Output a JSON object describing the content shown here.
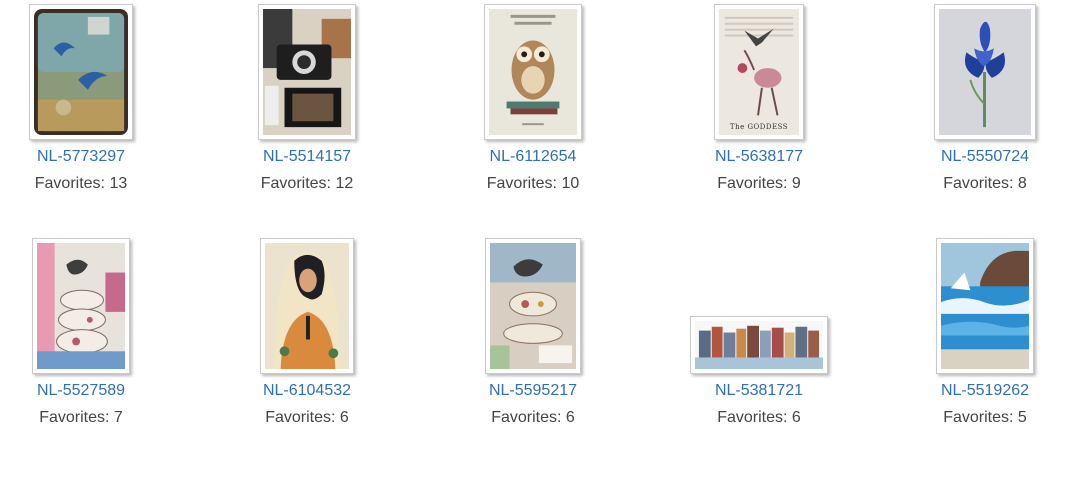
{
  "cards": [
    {
      "id": "NL-5773297",
      "favorites_label": "Favorites: 13",
      "thumbnail": "blue-birds-collage-icon"
    },
    {
      "id": "NL-5514157",
      "favorites_label": "Favorites: 12",
      "thumbnail": "camera-collage-icon"
    },
    {
      "id": "NL-6112654",
      "favorites_label": "Favorites: 10",
      "thumbnail": "owl-on-books-icon"
    },
    {
      "id": "NL-5638177",
      "favorites_label": "Favorites: 9",
      "thumbnail": "goddess-heron-icon"
    },
    {
      "id": "NL-5550724",
      "favorites_label": "Favorites: 8",
      "thumbnail": "blue-iris-icon"
    },
    {
      "id": "NL-5527589",
      "favorites_label": "Favorites: 7",
      "thumbnail": "bird-teacups-icon"
    },
    {
      "id": "NL-6104532",
      "favorites_label": "Favorites: 6",
      "thumbnail": "woman-portrait-icon"
    },
    {
      "id": "NL-5595217",
      "favorites_label": "Favorites: 6",
      "thumbnail": "bird-teacup-icon"
    },
    {
      "id": "NL-5381721",
      "favorites_label": "Favorites: 6",
      "thumbnail": "canal-houses-icon"
    },
    {
      "id": "NL-5519262",
      "favorites_label": "Favorites: 5",
      "thumbnail": "seaside-cliff-icon"
    }
  ],
  "artwork_text": {
    "goddess_caption": "The GODDESS"
  },
  "colors": {
    "link": "#2e6fb5",
    "text": "#444444",
    "frame_border": "#c9c9c9"
  }
}
